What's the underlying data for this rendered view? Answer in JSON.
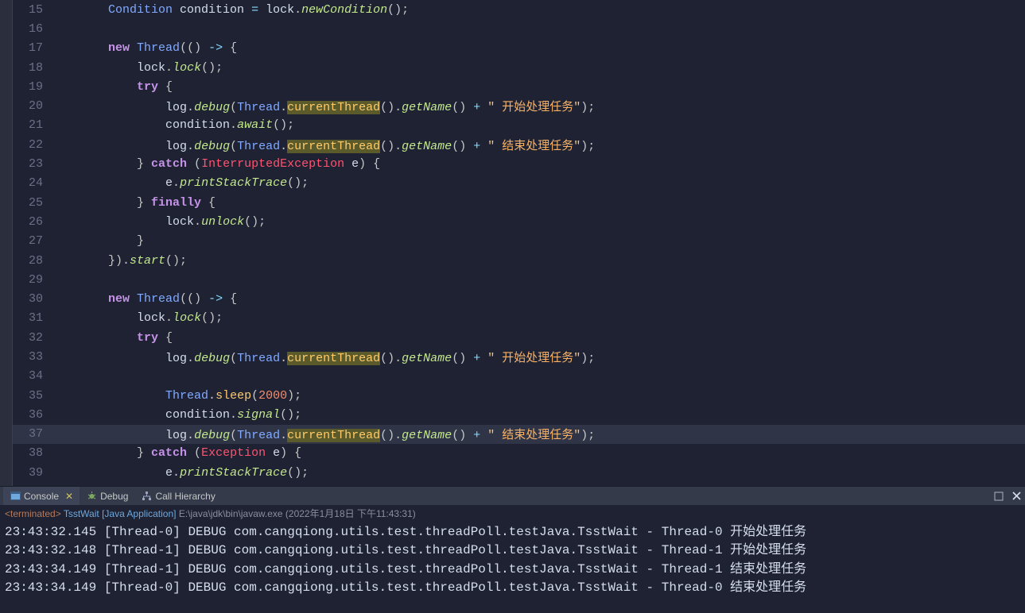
{
  "code": {
    "lines": [
      {
        "n": 15,
        "tokens": [
          [
            "        ",
            ""
          ],
          [
            "Condition",
            "tok-type"
          ],
          [
            " ",
            ""
          ],
          [
            "condition",
            "tok-id"
          ],
          [
            " ",
            ""
          ],
          [
            "=",
            "tok-op"
          ],
          [
            " ",
            ""
          ],
          [
            "lock",
            "tok-id"
          ],
          [
            ".",
            ""
          ],
          [
            "newCondition",
            "tok-mthd"
          ],
          [
            "();",
            ""
          ]
        ]
      },
      {
        "n": 16,
        "tokens": []
      },
      {
        "n": 17,
        "tokens": [
          [
            "        ",
            ""
          ],
          [
            "new",
            "tok-kw"
          ],
          [
            " ",
            ""
          ],
          [
            "Thread",
            "tok-type"
          ],
          [
            "(() ",
            ""
          ],
          [
            "->",
            "tok-op"
          ],
          [
            " {",
            ""
          ]
        ]
      },
      {
        "n": 18,
        "tokens": [
          [
            "            ",
            ""
          ],
          [
            "lock",
            "tok-id"
          ],
          [
            ".",
            ""
          ],
          [
            "lock",
            "tok-mthd"
          ],
          [
            "();",
            ""
          ]
        ]
      },
      {
        "n": 19,
        "tokens": [
          [
            "            ",
            ""
          ],
          [
            "try",
            "tok-kw"
          ],
          [
            " {",
            ""
          ]
        ]
      },
      {
        "n": 20,
        "tokens": [
          [
            "                ",
            ""
          ],
          [
            "log",
            "tok-id"
          ],
          [
            ".",
            ""
          ],
          [
            "debug",
            "tok-mthd"
          ],
          [
            "(",
            ""
          ],
          [
            "Thread",
            "tok-type"
          ],
          [
            ".",
            ""
          ],
          [
            "currentThread",
            "tok-call tok-hl"
          ],
          [
            "().",
            ""
          ],
          [
            "getName",
            "tok-mthd"
          ],
          [
            "() ",
            ""
          ],
          [
            "+",
            "tok-op"
          ],
          [
            " ",
            ""
          ],
          [
            "\"",
            "tok-str"
          ],
          [
            " 开始处理任务",
            "tok-strcn"
          ],
          [
            "\"",
            "tok-str"
          ],
          [
            ");",
            ""
          ]
        ]
      },
      {
        "n": 21,
        "tokens": [
          [
            "                ",
            ""
          ],
          [
            "condition",
            "tok-id"
          ],
          [
            ".",
            ""
          ],
          [
            "await",
            "tok-mthd"
          ],
          [
            "();",
            ""
          ]
        ]
      },
      {
        "n": 22,
        "tokens": [
          [
            "                ",
            ""
          ],
          [
            "log",
            "tok-id"
          ],
          [
            ".",
            ""
          ],
          [
            "debug",
            "tok-mthd"
          ],
          [
            "(",
            ""
          ],
          [
            "Thread",
            "tok-type"
          ],
          [
            ".",
            ""
          ],
          [
            "currentThread",
            "tok-call tok-hl"
          ],
          [
            "().",
            ""
          ],
          [
            "getName",
            "tok-mthd"
          ],
          [
            "() ",
            ""
          ],
          [
            "+",
            "tok-op"
          ],
          [
            " ",
            ""
          ],
          [
            "\"",
            "tok-str"
          ],
          [
            " 结束处理任务",
            "tok-strcn"
          ],
          [
            "\"",
            "tok-str"
          ],
          [
            ");",
            ""
          ]
        ]
      },
      {
        "n": 23,
        "tokens": [
          [
            "            } ",
            ""
          ],
          [
            "catch",
            "tok-kw"
          ],
          [
            " (",
            ""
          ],
          [
            "InterruptedException",
            "tok-exc"
          ],
          [
            " ",
            ""
          ],
          [
            "e",
            "tok-id"
          ],
          [
            ") {",
            ""
          ]
        ]
      },
      {
        "n": 24,
        "tokens": [
          [
            "                ",
            ""
          ],
          [
            "e",
            "tok-id"
          ],
          [
            ".",
            ""
          ],
          [
            "printStackTrace",
            "tok-mthd"
          ],
          [
            "();",
            ""
          ]
        ]
      },
      {
        "n": 25,
        "tokens": [
          [
            "            } ",
            ""
          ],
          [
            "finally",
            "tok-kw"
          ],
          [
            " {",
            ""
          ]
        ]
      },
      {
        "n": 26,
        "tokens": [
          [
            "                ",
            ""
          ],
          [
            "lock",
            "tok-id"
          ],
          [
            ".",
            ""
          ],
          [
            "unlock",
            "tok-mthd"
          ],
          [
            "();",
            ""
          ]
        ]
      },
      {
        "n": 27,
        "tokens": [
          [
            "            }",
            ""
          ]
        ]
      },
      {
        "n": 28,
        "tokens": [
          [
            "        }).",
            ""
          ],
          [
            "start",
            "tok-mthd"
          ],
          [
            "();",
            ""
          ]
        ]
      },
      {
        "n": 29,
        "tokens": []
      },
      {
        "n": 30,
        "tokens": [
          [
            "        ",
            ""
          ],
          [
            "new",
            "tok-kw"
          ],
          [
            " ",
            ""
          ],
          [
            "Thread",
            "tok-type"
          ],
          [
            "(() ",
            ""
          ],
          [
            "->",
            "tok-op"
          ],
          [
            " {",
            ""
          ]
        ]
      },
      {
        "n": 31,
        "tokens": [
          [
            "            ",
            ""
          ],
          [
            "lock",
            "tok-id"
          ],
          [
            ".",
            ""
          ],
          [
            "lock",
            "tok-mthd"
          ],
          [
            "();",
            ""
          ]
        ]
      },
      {
        "n": 32,
        "tokens": [
          [
            "            ",
            ""
          ],
          [
            "try",
            "tok-kw"
          ],
          [
            " {",
            ""
          ]
        ]
      },
      {
        "n": 33,
        "tokens": [
          [
            "                ",
            ""
          ],
          [
            "log",
            "tok-id"
          ],
          [
            ".",
            ""
          ],
          [
            "debug",
            "tok-mthd"
          ],
          [
            "(",
            ""
          ],
          [
            "Thread",
            "tok-type"
          ],
          [
            ".",
            ""
          ],
          [
            "currentThread",
            "tok-call tok-hl"
          ],
          [
            "().",
            ""
          ],
          [
            "getName",
            "tok-mthd"
          ],
          [
            "() ",
            ""
          ],
          [
            "+",
            "tok-op"
          ],
          [
            " ",
            ""
          ],
          [
            "\"",
            "tok-str"
          ],
          [
            " 开始处理任务",
            "tok-strcn"
          ],
          [
            "\"",
            "tok-str"
          ],
          [
            ");",
            ""
          ]
        ]
      },
      {
        "n": 34,
        "tokens": []
      },
      {
        "n": 35,
        "tokens": [
          [
            "                ",
            ""
          ],
          [
            "Thread",
            "tok-type"
          ],
          [
            ".",
            ""
          ],
          [
            "sleep",
            "tok-call"
          ],
          [
            "(",
            ""
          ],
          [
            "2000",
            "tok-num"
          ],
          [
            ");",
            ""
          ]
        ]
      },
      {
        "n": 36,
        "tokens": [
          [
            "                ",
            ""
          ],
          [
            "condition",
            "tok-id"
          ],
          [
            ".",
            ""
          ],
          [
            "signal",
            "tok-mthd"
          ],
          [
            "();",
            ""
          ]
        ]
      },
      {
        "n": 37,
        "hl": true,
        "tokens": [
          [
            "                ",
            ""
          ],
          [
            "log",
            "tok-id"
          ],
          [
            ".",
            ""
          ],
          [
            "debug",
            "tok-mthd"
          ],
          [
            "(",
            ""
          ],
          [
            "Thread",
            "tok-type"
          ],
          [
            ".",
            ""
          ],
          [
            "currentThread",
            "tok-call tok-hl"
          ],
          [
            "().",
            ""
          ],
          [
            "getName",
            "tok-mthd"
          ],
          [
            "() ",
            ""
          ],
          [
            "+",
            "tok-op"
          ],
          [
            " ",
            ""
          ],
          [
            "\"",
            "tok-str"
          ],
          [
            " 结束处理任务",
            "tok-strcn"
          ],
          [
            "\"",
            "tok-str"
          ],
          [
            ");",
            ""
          ]
        ]
      },
      {
        "n": 38,
        "tokens": [
          [
            "            } ",
            ""
          ],
          [
            "catch",
            "tok-kw"
          ],
          [
            " (",
            ""
          ],
          [
            "Exception",
            "tok-exc"
          ],
          [
            " ",
            ""
          ],
          [
            "e",
            "tok-id"
          ],
          [
            ") {",
            ""
          ]
        ]
      },
      {
        "n": 39,
        "tokens": [
          [
            "                ",
            ""
          ],
          [
            "e",
            "tok-id"
          ],
          [
            ".",
            ""
          ],
          [
            "printStackTrace",
            "tok-mthd"
          ],
          [
            "();",
            ""
          ]
        ]
      }
    ]
  },
  "panel": {
    "tabs": {
      "console": "Console",
      "debug": "Debug",
      "callhier": "Call Hierarchy"
    }
  },
  "terminated": {
    "tag": "<terminated>",
    "app": "TsstWait [Java Application]",
    "path": "E:\\java\\jdk\\bin\\javaw.exe",
    "ts": "(2022年1月18日 下午11:43:31)"
  },
  "console_lines": [
    "23:43:32.145 [Thread-0] DEBUG com.cangqiong.utils.test.threadPoll.testJava.TsstWait - Thread-0 开始处理任务",
    "23:43:32.148 [Thread-1] DEBUG com.cangqiong.utils.test.threadPoll.testJava.TsstWait - Thread-1 开始处理任务",
    "23:43:34.149 [Thread-1] DEBUG com.cangqiong.utils.test.threadPoll.testJava.TsstWait - Thread-1 结束处理任务",
    "23:43:34.149 [Thread-0] DEBUG com.cangqiong.utils.test.threadPoll.testJava.TsstWait - Thread-0 结束处理任务"
  ]
}
